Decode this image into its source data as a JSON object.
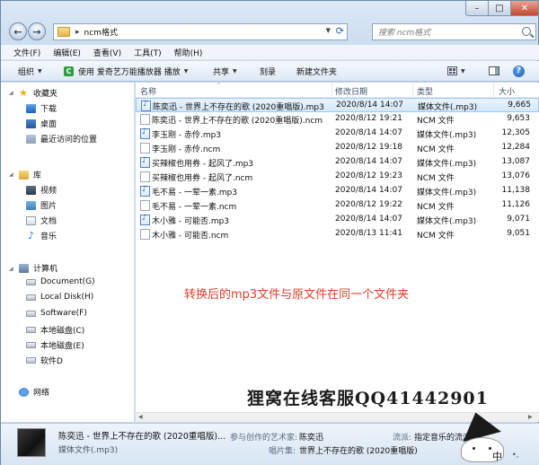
{
  "window": {
    "nav_back": "←",
    "nav_forward": "→",
    "address_separator": "▸",
    "address_path": "ncm格式",
    "search_placeholder": "搜索 ncm格式",
    "ctl_min": "–",
    "ctl_max": "□",
    "ctl_close": "✕"
  },
  "menubar": [
    "文件(F)",
    "编辑(E)",
    "查看(V)",
    "工具(T)",
    "帮助(H)"
  ],
  "toolbar": {
    "organize": "组织",
    "open_with": "使用 爱奇艺万能播放器 播放",
    "share": "共享",
    "burn": "刻录",
    "new_folder": "新建文件夹",
    "help": "?"
  },
  "nav": {
    "favorites": "收藏夹",
    "downloads": "下载",
    "desktop": "桌面",
    "recent": "最近访问的位置",
    "libraries": "库",
    "videos": "视频",
    "pictures": "图片",
    "documents": "文档",
    "music": "音乐",
    "computer": "计算机",
    "drives": [
      "Document(G)",
      "Local Disk(H)",
      "Software(F)",
      "本地磁盘(C)",
      "本地磁盘(E)",
      "软件D"
    ],
    "network": "网络"
  },
  "columns": {
    "name": "名称",
    "date": "修改日期",
    "type": "类型",
    "size": "大小"
  },
  "files": [
    {
      "name": "陈奕迅 - 世界上不存在的歌 (2020重唱版).mp3",
      "date": "2020/8/14 14:07",
      "type": "媒体文件(.mp3)",
      "size": "9,665",
      "kind": "mp3",
      "selected": true
    },
    {
      "name": "陈奕迅 - 世界上不存在的歌 (2020重唱版).ncm",
      "date": "2020/8/12 19:21",
      "type": "NCM 文件",
      "size": "9,653",
      "kind": "ncm",
      "selected": false
    },
    {
      "name": "李玉刚 - 赤伶.mp3",
      "date": "2020/8/14 14:07",
      "type": "媒体文件(.mp3)",
      "size": "12,305",
      "kind": "mp3",
      "selected": false
    },
    {
      "name": "李玉刚 - 赤伶.ncm",
      "date": "2020/8/12 19:18",
      "type": "NCM 文件",
      "size": "12,284",
      "kind": "ncm",
      "selected": false
    },
    {
      "name": "买辣椒也用券 - 起风了.mp3",
      "date": "2020/8/14 14:07",
      "type": "媒体文件(.mp3)",
      "size": "13,087",
      "kind": "mp3",
      "selected": false
    },
    {
      "name": "买辣椒也用券 - 起风了.ncm",
      "date": "2020/8/12 19:23",
      "type": "NCM 文件",
      "size": "13,076",
      "kind": "ncm",
      "selected": false
    },
    {
      "name": "毛不易 - 一荤一素.mp3",
      "date": "2020/8/14 14:07",
      "type": "媒体文件(.mp3)",
      "size": "11,138",
      "kind": "mp3",
      "selected": false
    },
    {
      "name": "毛不易 - 一荤一素.ncm",
      "date": "2020/8/12 19:22",
      "type": "NCM 文件",
      "size": "11,126",
      "kind": "ncm",
      "selected": false
    },
    {
      "name": "木小雅 - 可能否.mp3",
      "date": "2020/8/14 14:07",
      "type": "媒体文件(.mp3)",
      "size": "9,071",
      "kind": "mp3",
      "selected": false
    },
    {
      "name": "木小雅 - 可能否.ncm",
      "date": "2020/8/13 11:41",
      "type": "NCM 文件",
      "size": "9,051",
      "kind": "ncm",
      "selected": false
    }
  ],
  "annotation": "转换后的mp3文件与原文件在同一个文件夹",
  "watermark": "狸窝在线客服QQ41442901",
  "details": {
    "title": "陈奕迅 - 世界上不存在的歌 (2020重唱版)...",
    "type": "媒体文件(.mp3)",
    "artist_label": "参与创作的艺术家:",
    "artist_value": "陈奕迅",
    "album_label": "唱片集:",
    "album_value": "世界上不存在的歌 (2020重唱版)",
    "genre_label": "流派:",
    "genre_value": "指定音乐的流派"
  },
  "ime": {
    "text": "中",
    "dot": "•,"
  }
}
